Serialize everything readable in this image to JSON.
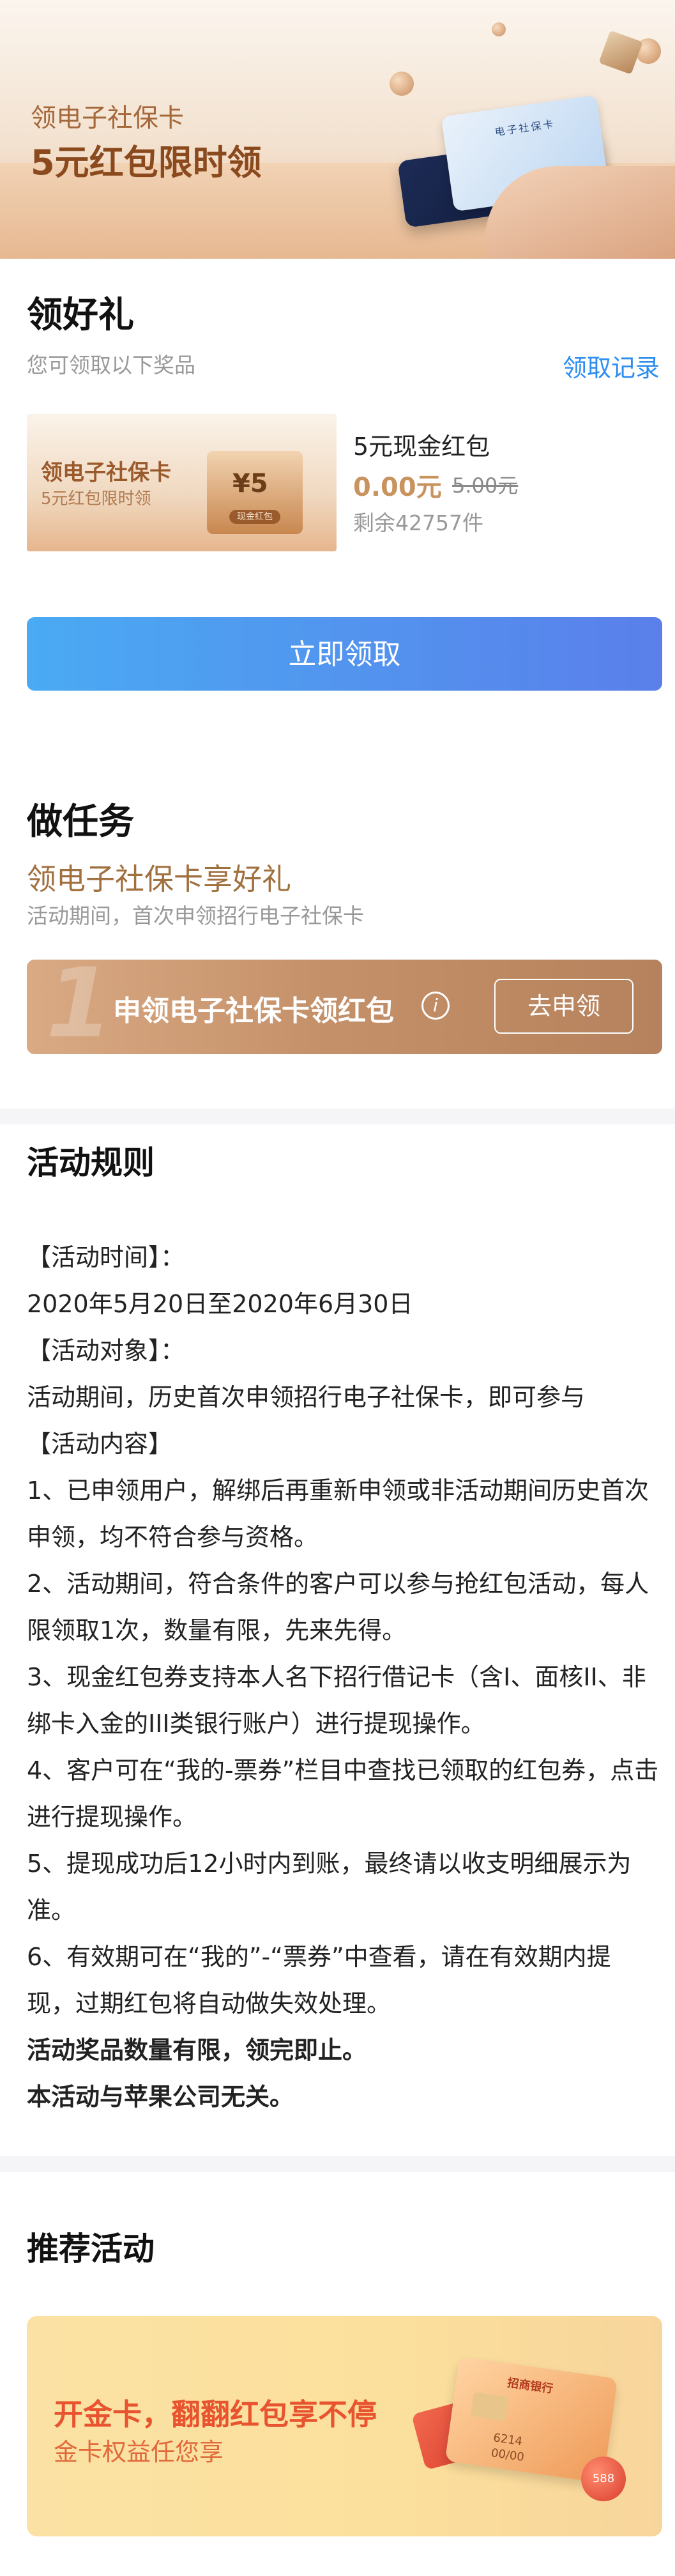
{
  "hero": {
    "subtitle": "领电子社保卡",
    "title": "5元红包限时领",
    "card_text": "电子社保卡"
  },
  "gift": {
    "title": "领好礼",
    "subtitle": "您可领取以下奖品",
    "record_link": "领取记录",
    "prize": {
      "image_title": "领电子社保卡",
      "image_subtitle": "5元红包限时领",
      "envelope_amount": "¥5",
      "envelope_tag": "现金红包",
      "name": "5元现金红包",
      "price": "0.00元",
      "original_price": "5.00元",
      "remaining": "剩余42757件"
    },
    "claim_button": "立即领取"
  },
  "task": {
    "title": "做任务",
    "subtitle": "领电子社保卡享好礼",
    "description": "活动期间，首次申领招行电子社保卡",
    "item": {
      "index": "1",
      "label": "申领电子社保卡领红包",
      "info_symbol": "i",
      "button": "去申领"
    }
  },
  "rules": {
    "title": "活动规则",
    "lines": [
      "【活动时间】：",
      "2020年5月20日至2020年6月30日",
      "【活动对象】：",
      "活动期间，历史首次申领招行电子社保卡，即可参与",
      "【活动内容】",
      "1、已申领用户，解绑后再重新申领或非活动期间历史首次申领，均不符合参与资格。",
      "2、活动期间，符合条件的客户可以参与抢红包活动，每人限领取1次，数量有限，先来先得。",
      "3、现金红包券支持本人名下招行借记卡（含I、面核II、非绑卡入金的III类银行账户）进行提现操作。",
      "4、客户可在“我的-票券”栏目中查找已领取的红包券，点击进行提现操作。",
      "5、提现成功后12小时内到账，最终请以收支明细展示为准。",
      "6、有效期可在“我的”-“票券”中查看，请在有效期内提现，过期红包将自动做失效处理。"
    ],
    "bold_lines": [
      "活动奖品数量有限，领完即止。",
      "本活动与苹果公司无关。"
    ]
  },
  "recommend": {
    "title": "推荐活动",
    "card": {
      "title": "开金卡，翻翻红包享不停",
      "subtitle": "金卡权益任您享",
      "bank_name": "招商银行",
      "card_number": "6214",
      "card_expiry": "00/00",
      "coin_amount": "588"
    }
  },
  "colors": {
    "brand_gold": "#a1703f",
    "link_blue": "#2c8df0",
    "button_gradient_start": "#4aaaf3",
    "button_gradient_end": "#5a7fea",
    "promo_red": "#e8542f"
  }
}
